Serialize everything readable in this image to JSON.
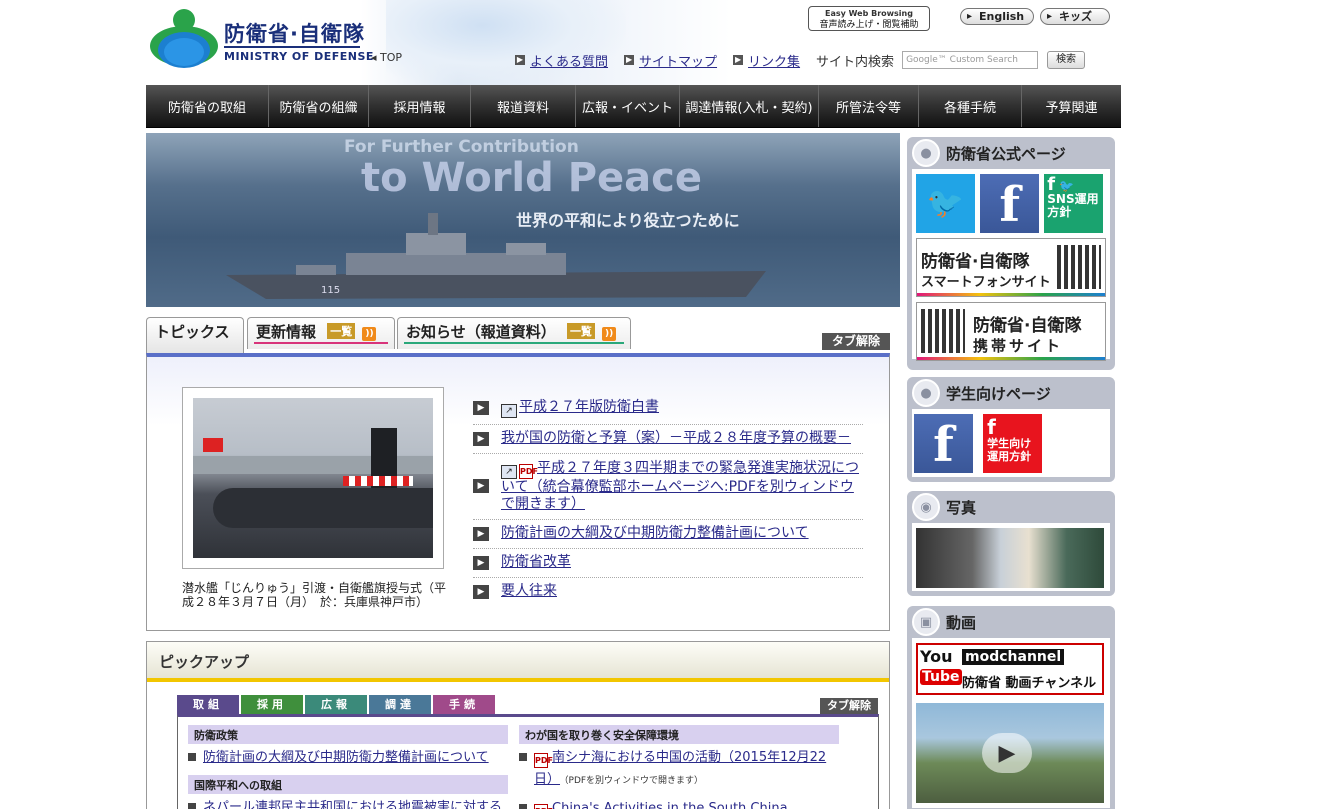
{
  "header": {
    "logo_jp": "防衛省·自衛隊",
    "logo_en": "MINISTRY OF DEFENSE",
    "top_link": "◂ TOP",
    "easy_browse_line1": "Easy Web Browsing",
    "easy_browse_line2": "音声読み上げ・閲覧補助",
    "english": "English",
    "kids": "キッズ",
    "links": [
      "よくある質問",
      "サイトマップ",
      "リンク集"
    ],
    "search_label": "サイト内検索",
    "search_placeholder": "Google™ Custom Search",
    "search_button": "検索"
  },
  "nav": [
    "防衛省の取組",
    "防衛省の組織",
    "採用情報",
    "報道資料",
    "広報・イベント",
    "調達情報(入札・契約)",
    "所管法令等",
    "各種手続",
    "予算関連"
  ],
  "hero": {
    "en_line1": "For Further Contribution",
    "en_line2": "to World Peace",
    "jp_line": "世界の平和により役立つために"
  },
  "topics": {
    "tab_topics": "トピックス",
    "tab_updates": "更新情報",
    "tab_news": "お知らせ（報道資料）",
    "ichiran": "一覧",
    "rss": "RSS",
    "untab": "タブ解除",
    "caption": "潜水艦「じんりゅう」引渡・自衛艦旗授与式（平成２８年３月７日（月）　於：兵庫県神戸市）",
    "items": [
      {
        "text": "平成２７年版防衛白書",
        "link_icon": true,
        "pdf_icon": false
      },
      {
        "text": "我が国の防衛と予算（案）－平成２８年度予算の概要－",
        "link_icon": false,
        "pdf_icon": false
      },
      {
        "text": "平成２７年度３四半期までの緊急発進実施状況について（統合幕僚監部ホームページへ:PDFを別ウィンドウで開きます）",
        "link_icon": true,
        "pdf_icon": true
      },
      {
        "text": "防衛計画の大綱及び中期防衛力整備計画について",
        "link_icon": false,
        "pdf_icon": false
      },
      {
        "text": "防衛省改革",
        "link_icon": false,
        "pdf_icon": false
      },
      {
        "text": "要人往来",
        "link_icon": false,
        "pdf_icon": false
      }
    ]
  },
  "pickup": {
    "title": "ピックアップ",
    "tabs": [
      {
        "label": "取組",
        "color": "#5a4a8c"
      },
      {
        "label": "採用",
        "color": "#3f8f3c"
      },
      {
        "label": "広報",
        "color": "#3b8a7a"
      },
      {
        "label": "調達",
        "color": "#4a7898"
      },
      {
        "label": "手続",
        "color": "#a04a8a"
      }
    ],
    "untab": "タブ解除",
    "left": [
      {
        "category": "防衛政策",
        "link": "防衛計画の大綱及び中期防衛力整備計画について"
      },
      {
        "category": "国際平和への取組",
        "link": "ネパール連邦民主共和国における地震被害に対する"
      }
    ],
    "right_category": "わが国を取り巻く安全保障環境",
    "right_links": [
      {
        "text": "南シナ海における中国の活動（2015年12月22日）",
        "note": "（PDFを別ウィンドウで開きます）"
      },
      {
        "text": "China's Activities in the South China",
        "note": ""
      }
    ]
  },
  "sidebar": {
    "official_title": "防衛省公式ページ",
    "sns_policy": "SNS運用方針",
    "smartphone_site": "防衛省·自衛隊",
    "smartphone_sub": "スマートフォンサイト",
    "mobile_site": "防衛省·自衛隊",
    "mobile_sub": "携帯サイト",
    "students_title": "学生向けページ",
    "students_policy": "学生向け運用方針",
    "photo_title": "写真",
    "video_title": "動画",
    "youtube_you": "You",
    "youtube_tube": "Tube",
    "modchannel": "modchannel",
    "modchannel_sub": "防衛省 動画チャンネル"
  }
}
